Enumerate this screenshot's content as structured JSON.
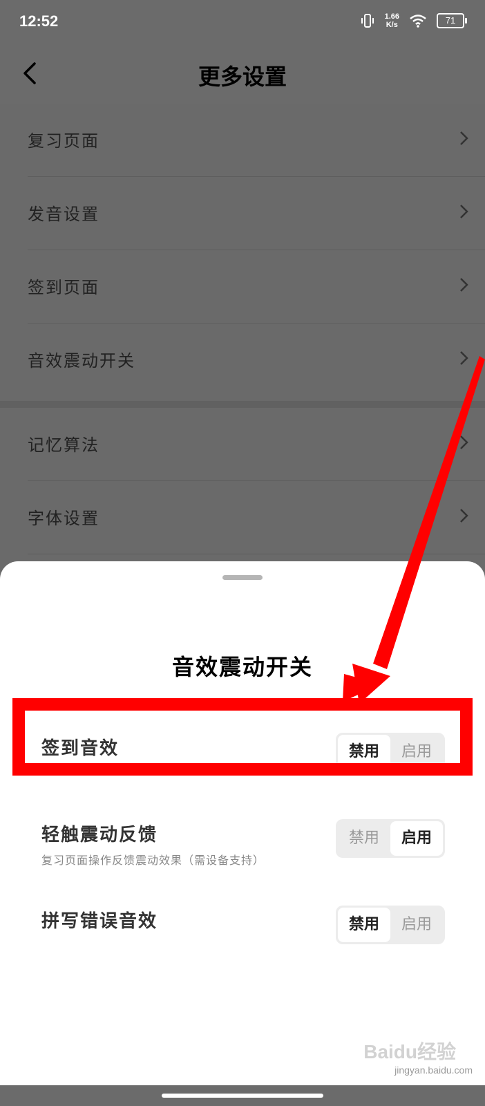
{
  "status_bar": {
    "time": "12:52",
    "net_speed_value": "1.66",
    "net_speed_unit": "K/s",
    "battery": "71"
  },
  "header": {
    "title": "更多设置",
    "back_icon": "chevron-left-icon"
  },
  "settings_list": {
    "group1": [
      {
        "label": "复习页面"
      },
      {
        "label": "发音设置"
      },
      {
        "label": "签到页面"
      },
      {
        "label": "音效震动开关"
      }
    ],
    "group2": [
      {
        "label": "记忆算法"
      },
      {
        "label": "字体设置"
      }
    ]
  },
  "sheet": {
    "title": "音效震动开关",
    "options": [
      {
        "name": "签到音效",
        "disable": "禁用",
        "enable": "启用",
        "selected": "禁用"
      },
      {
        "name": "轻触震动反馈",
        "description": "复习页面操作反馈震动效果（需设备支持）",
        "disable": "禁用",
        "enable": "启用",
        "selected": "启用"
      },
      {
        "name": "拼写错误音效",
        "disable": "禁用",
        "enable": "启用",
        "selected": "禁用"
      }
    ]
  },
  "annotation": {
    "highlight_color": "#ff0000"
  },
  "watermark": {
    "text": "Baidu经验",
    "sub": "jingyan.baidu.com"
  }
}
